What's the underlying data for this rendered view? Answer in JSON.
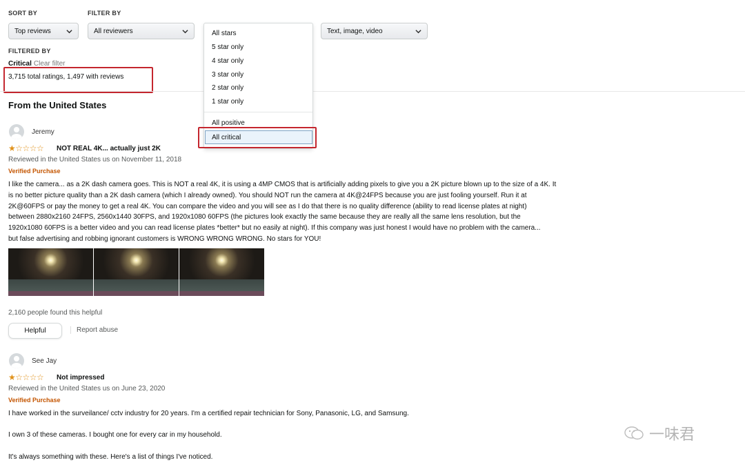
{
  "controls": {
    "sort_label": "SORT BY",
    "filter_label": "FILTER BY",
    "sort_value": "Top reviews",
    "reviewers_value": "All reviewers",
    "format_value": "Text, image, video"
  },
  "star_filter": {
    "options": [
      "All stars",
      "5 star only",
      "4 star only",
      "3 star only",
      "2 star only",
      "1 star only",
      "All positive"
    ],
    "selected": "All critical"
  },
  "filtered": {
    "label": "FILTERED BY",
    "active": "Critical",
    "clear": "Clear filter",
    "totals": "3,715 total ratings, 1,497 with reviews"
  },
  "section_title": "From the United States",
  "reviews": [
    {
      "name": "Jeremy",
      "rating": 1,
      "title": "NOT REAL 4K... actually just 2K",
      "date": "Reviewed in the United States us on November 11, 2018",
      "verified": "Verified Purchase",
      "body": [
        "I like the camera... as a 2K dash camera goes. This is NOT a real 4K, it is using a 4MP CMOS that is artificially adding pixels to give you a 2K picture blown up to the size of a 4K. It",
        "is no better picture quality than a 2K dash camera (which I already owned). You should NOT run the camera at 4K@24FPS because you are just fooling yourself. Run it at",
        "2K@60FPS or pay the money to get a real 4K. You can compare the video and you will see as I do that there is no quality difference (ability to read license plates at night)",
        "between 2880x2160 24FPS, 2560x1440 30FPS, and 1920x1080 60FPS (the pictures look exactly the same because they are really all the same lens resolution, but the",
        "1920x1080 60FPS is a better video and you can read license plates *better* but no easily at night). If this company was just honest I would have no problem with the camera...",
        "but false advertising and robbing ignorant customers is WRONG WRONG WRONG. No stars for YOU!"
      ],
      "helpful_count": "2,160 people found this helpful",
      "helpful_label": "Helpful",
      "report_label": "Report abuse"
    },
    {
      "name": "See Jay",
      "rating": 1,
      "title": "Not impressed",
      "date": "Reviewed in the United States us on June 23, 2020",
      "verified": "Verified Purchase",
      "body": [
        "I have worked in the surveilance/ cctv industry for 20 years. I'm a certified repair technician for Sony, Panasonic, LG, and Samsung.",
        "I own 3 of these cameras. I bought one for every car in my household.",
        "It's always something with these. Here's a list of things I've noticed."
      ]
    }
  ],
  "watermark": "一味君",
  "colors": {
    "star": "#e0911a",
    "verified": "#c45500",
    "highlight": "#c4262e"
  }
}
